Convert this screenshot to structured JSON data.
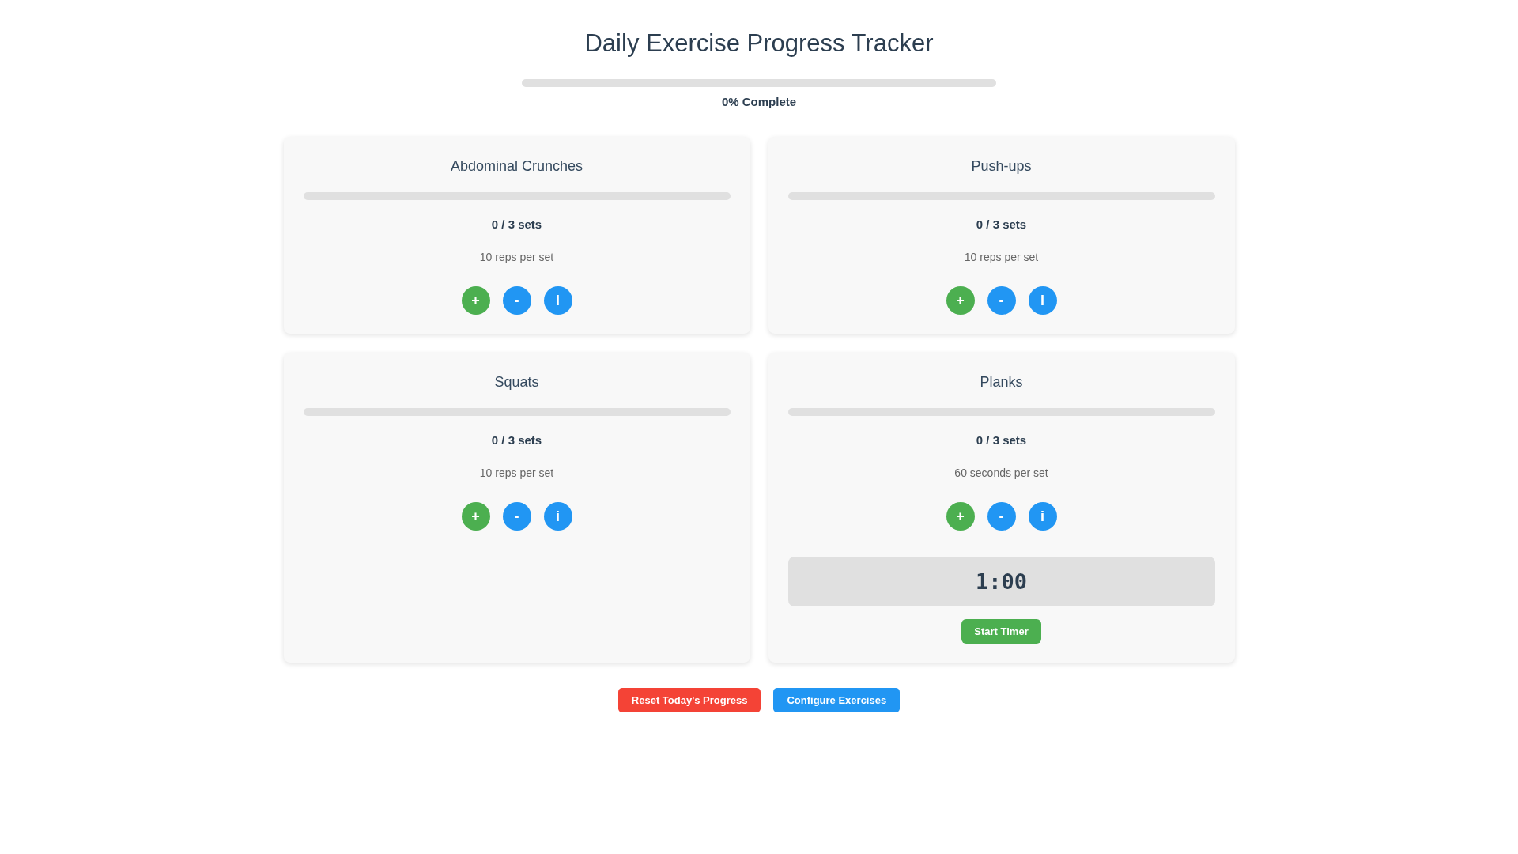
{
  "title": "Daily Exercise Progress Tracker",
  "overall": {
    "level": 0,
    "label": "0% Complete"
  },
  "exercises": [
    {
      "kind": "sets",
      "name": "Abdominal Crunches",
      "level": 0,
      "sets": "0 / 3 sets",
      "detail": "10 reps per set",
      "buttons": [
        "+",
        "-",
        "i"
      ]
    },
    {
      "kind": "sets",
      "name": "Push-ups",
      "level": 0,
      "sets": "0 / 3 sets",
      "detail": "10 reps per set",
      "buttons": [
        "+",
        "-",
        "i"
      ]
    },
    {
      "kind": "sets",
      "name": "Squats",
      "level": 0,
      "sets": "0 / 3 sets",
      "detail": "10 reps per set",
      "buttons": [
        "+",
        "-",
        "i"
      ]
    },
    {
      "kind": "timer",
      "name": "Planks",
      "level": 0,
      "sets": "0 / 3 sets",
      "detail": "60 seconds per set",
      "buttons": [
        "+",
        "-",
        "i"
      ],
      "timer": "1:00",
      "timer_button": "Start Timer"
    }
  ],
  "actions": [
    {
      "kind": "danger",
      "label": "Reset Today's Progress"
    },
    {
      "kind": "primary",
      "label": "Configure Exercises"
    }
  ]
}
